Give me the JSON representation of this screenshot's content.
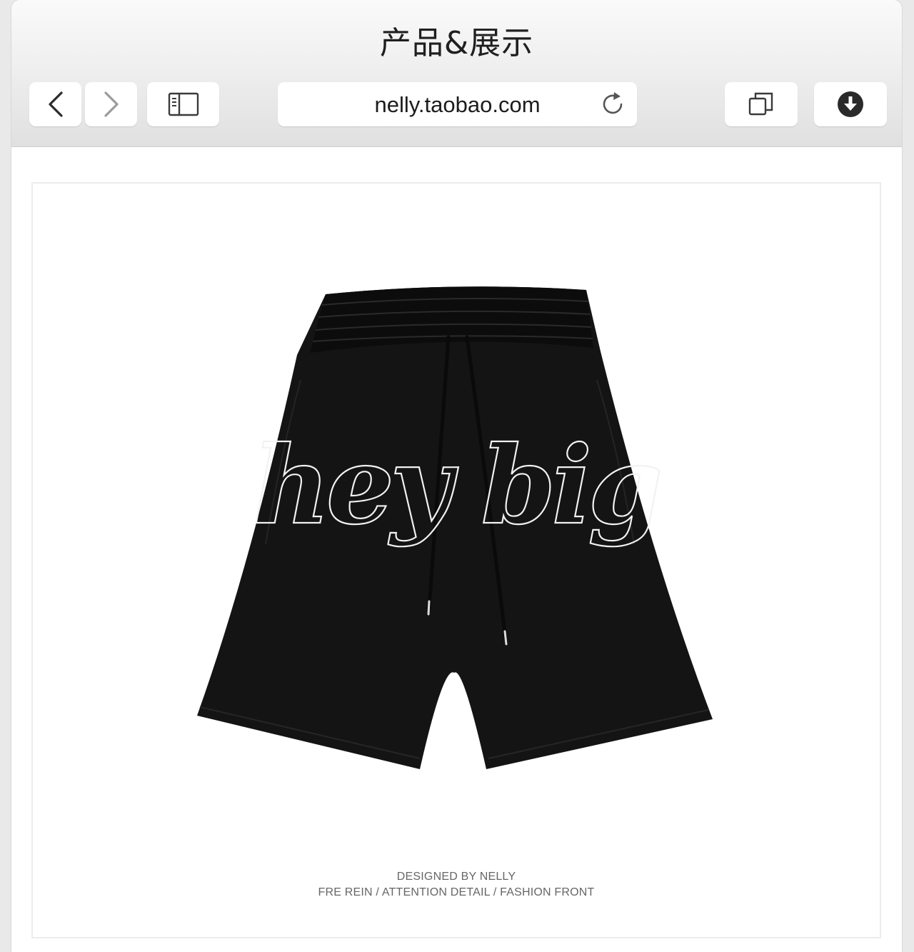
{
  "window": {
    "title": "产品&展示"
  },
  "toolbar": {
    "back_icon": "chevron-left",
    "forward_icon": "chevron-right",
    "sidebar_icon": "sidebar",
    "tabs_icon": "tabs-overview",
    "download_icon": "download-circle"
  },
  "address_bar": {
    "url": "nelly.taobao.com",
    "reload_icon": "reload"
  },
  "product": {
    "image": "black-drawstring-shorts",
    "print_text": "hey big",
    "caption_line1": "DESIGNED BY NELLY",
    "caption_line2": "FRE REIN / ATTENTION DETAIL / FASHION FRONT"
  },
  "colors": {
    "shorts": "#131313",
    "toolbar_gradient_top": "#fafafa",
    "toolbar_gradient_bottom": "#e0e0e0",
    "caption_text": "#666666"
  }
}
